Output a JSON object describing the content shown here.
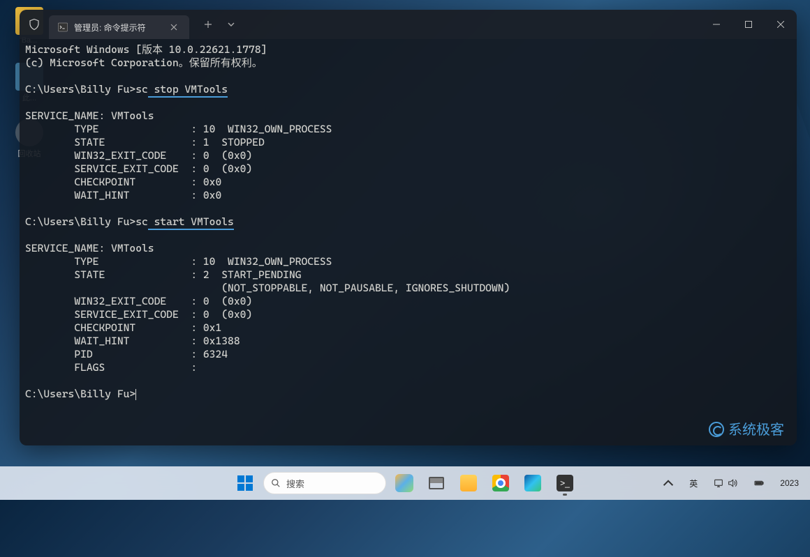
{
  "desktop": {
    "icon1_label": "Ba...",
    "icon2_label": "此...",
    "icon3_label": "回收站"
  },
  "terminal": {
    "tab_title": "管理员: 命令提示符",
    "header_line1": "Microsoft Windows [版本 10.0.22621.1778]",
    "header_line2": "(c) Microsoft Corporation。保留所有权利。",
    "prompt": "C:\\Users\\Billy Fu>",
    "cmd1_prefix": "sc",
    "cmd1_highlight": " stop VMTools",
    "out1": {
      "service_name_label": "SERVICE_NAME:",
      "service_name": "VMTools",
      "type_label": "TYPE",
      "type_val": ": 10  WIN32_OWN_PROCESS",
      "state_label": "STATE",
      "state_val": ": 1  STOPPED",
      "w32exit_label": "WIN32_EXIT_CODE",
      "w32exit_val": ": 0  (0x0)",
      "svexit_label": "SERVICE_EXIT_CODE",
      "svexit_val": ": 0  (0x0)",
      "ckpt_label": "CHECKPOINT",
      "ckpt_val": ": 0x0",
      "wait_label": "WAIT_HINT",
      "wait_val": ": 0x0"
    },
    "cmd2_prefix": "sc",
    "cmd2_highlight": " start VMTools",
    "out2": {
      "service_name_label": "SERVICE_NAME:",
      "service_name": "VMTools",
      "type_label": "TYPE",
      "type_val": ": 10  WIN32_OWN_PROCESS",
      "state_label": "STATE",
      "state_val": ": 2  START_PENDING",
      "state_extra": "(NOT_STOPPABLE, NOT_PAUSABLE, IGNORES_SHUTDOWN)",
      "w32exit_label": "WIN32_EXIT_CODE",
      "w32exit_val": ": 0  (0x0)",
      "svexit_label": "SERVICE_EXIT_CODE",
      "svexit_val": ": 0  (0x0)",
      "ckpt_label": "CHECKPOINT",
      "ckpt_val": ": 0x1",
      "wait_label": "WAIT_HINT",
      "wait_val": ": 0x1388",
      "pid_label": "PID",
      "pid_val": ": 6324",
      "flags_label": "FLAGS",
      "flags_val": ":"
    },
    "watermark": "系统极客"
  },
  "taskbar": {
    "search_placeholder": "搜索"
  },
  "tray": {
    "chevron": "^",
    "ime": "英",
    "year": "2023"
  }
}
